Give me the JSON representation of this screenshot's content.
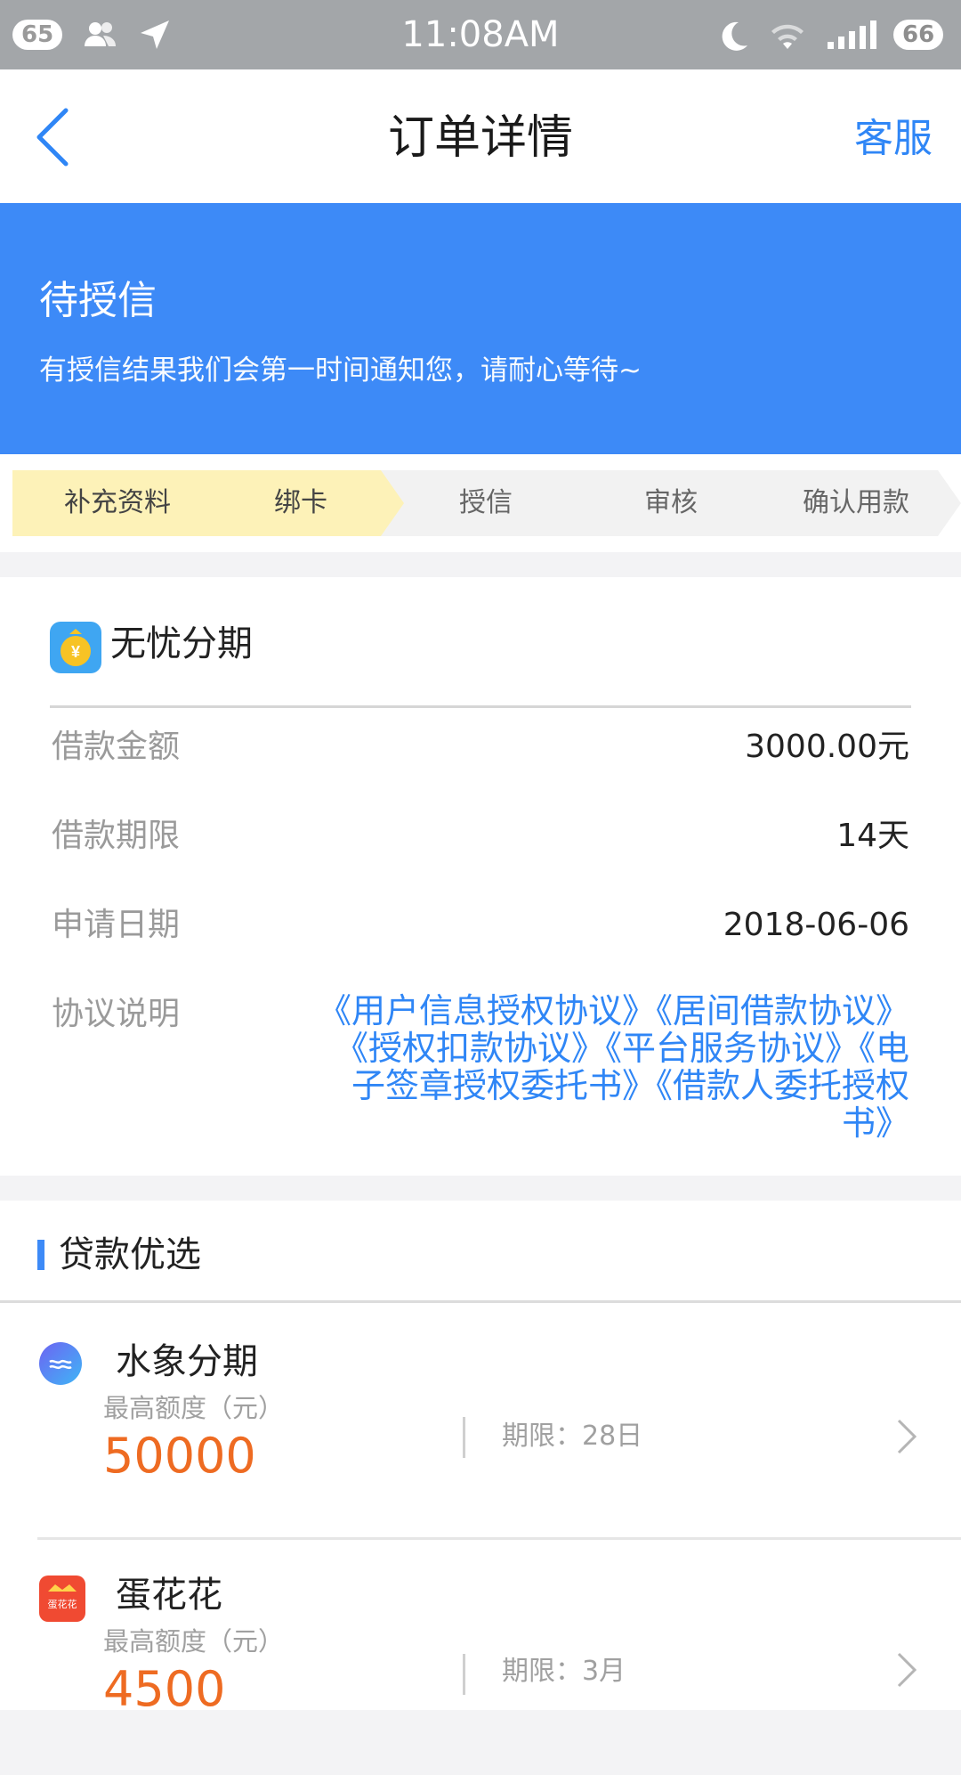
{
  "status_bar": {
    "badge_left": "65",
    "time": "11:08AM",
    "battery": "66"
  },
  "header": {
    "title": "订单详情",
    "service_label": "客服"
  },
  "banner": {
    "status": "待授信",
    "description": "有授信结果我们会第一时间通知您，请耐心等待~"
  },
  "steps": [
    {
      "label": "补充资料",
      "done": true
    },
    {
      "label": "绑卡",
      "done": true
    },
    {
      "label": "授信",
      "done": false
    },
    {
      "label": "审核",
      "done": false
    },
    {
      "label": "确认用款",
      "done": false
    }
  ],
  "order": {
    "product_name": "无忧分期",
    "rows": [
      {
        "label": "借款金额",
        "value": "3000.00元"
      },
      {
        "label": "借款期限",
        "value": "14天"
      },
      {
        "label": "申请日期",
        "value": "2018-06-06"
      }
    ],
    "agreements_label": "协议说明",
    "agreements": [
      "《用户信息授权协议》",
      "《居间借款协议》",
      "《授权扣款协议》",
      "《平台服务协议》",
      "《电子签章授权委托书》",
      "《借款人委托授权书》"
    ]
  },
  "loan_section": {
    "title": "贷款优选",
    "items": [
      {
        "name": "水象分期",
        "limit_label": "最高额度（元）",
        "amount": "50000",
        "term": "期限：28日"
      },
      {
        "name": "蛋花花",
        "logo_text": "蛋花花",
        "limit_label": "最高额度（元）",
        "amount": "4500",
        "term": "期限：3月"
      }
    ]
  },
  "colors": {
    "accent": "#3d8af7",
    "link": "#2f86f6",
    "amount": "#ee6b22",
    "step_done": "#fdf2b8"
  }
}
